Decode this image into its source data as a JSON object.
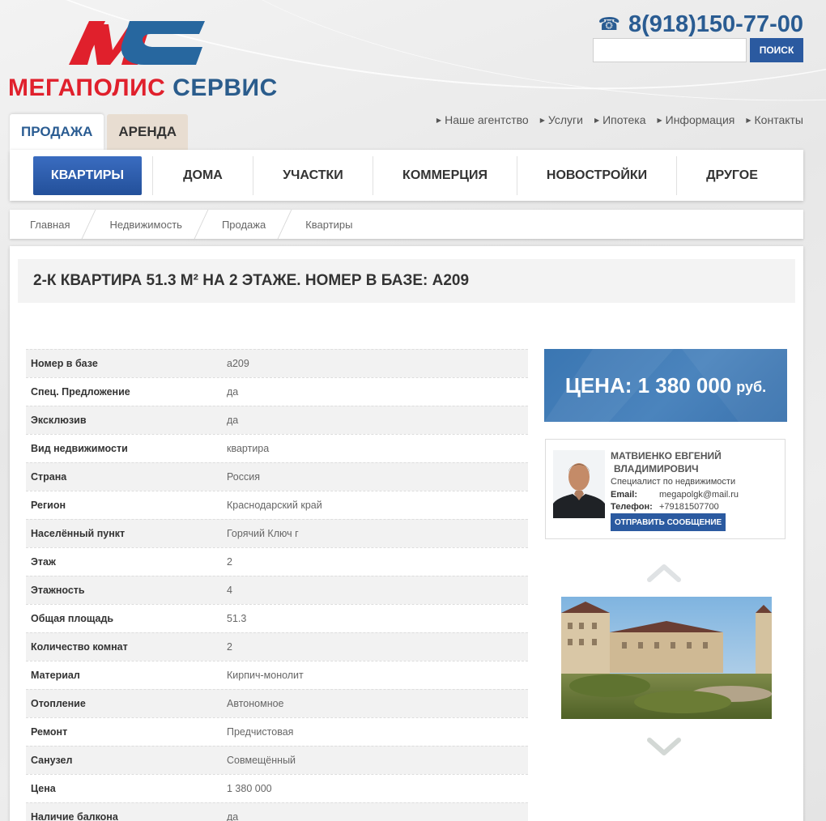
{
  "header": {
    "logo_text_part1": "МЕГАПОЛИС",
    "logo_text_part2": "СЕРВИС",
    "phone": "8(918)150-77-00",
    "search": {
      "placeholder": "",
      "button_label": "ПОИСК"
    }
  },
  "tabs": [
    {
      "label": "ПРОДАЖА",
      "active": true
    },
    {
      "label": "АРЕНДА",
      "active": false
    }
  ],
  "topnav": [
    "Наше агентство",
    "Услуги",
    "Ипотека",
    "Информация",
    "Контакты"
  ],
  "menu": [
    {
      "label": "КВАРТИРЫ",
      "active": true
    },
    {
      "label": "ДОМА",
      "active": false
    },
    {
      "label": "УЧАСТКИ",
      "active": false
    },
    {
      "label": "КОММЕРЦИЯ",
      "active": false
    },
    {
      "label": "НОВОСТРОЙКИ",
      "active": false
    },
    {
      "label": "ДРУГОЕ",
      "active": false
    }
  ],
  "breadcrumb": [
    "Главная",
    "Недвижимость",
    "Продажа",
    "Квартиры"
  ],
  "page_title": "2-К КВАРТИРА 51.3 М² НА 2 ЭТАЖЕ. НОМЕР В БАЗЕ: А209",
  "properties": [
    {
      "key": "Номер в базе",
      "value": "a209"
    },
    {
      "key": "Спец. Предложение",
      "value": "да"
    },
    {
      "key": "Эксклюзив",
      "value": "да"
    },
    {
      "key": "Вид недвижимости",
      "value": "квартира"
    },
    {
      "key": "Страна",
      "value": "Россия"
    },
    {
      "key": "Регион",
      "value": "Краснодарский край"
    },
    {
      "key": "Населённый пункт",
      "value": "Горячий Ключ г"
    },
    {
      "key": "Этаж",
      "value": "2"
    },
    {
      "key": "Этажность",
      "value": "4"
    },
    {
      "key": "Общая площадь",
      "value": "51.3"
    },
    {
      "key": "Количество комнат",
      "value": "2"
    },
    {
      "key": "Материал",
      "value": "Кирпич-монолит"
    },
    {
      "key": "Отопление",
      "value": "Автономное"
    },
    {
      "key": "Ремонт",
      "value": "Предчистовая"
    },
    {
      "key": "Санузел",
      "value": "Совмещённый"
    },
    {
      "key": "Цена",
      "value": "1 380 000"
    },
    {
      "key": "Наличие балкона",
      "value": "да"
    }
  ],
  "price": {
    "label": "ЦЕНА: 1 380 000",
    "currency": "руб."
  },
  "agent": {
    "name_line1": "МАТВИЕНКО ЕВГЕНИЙ",
    "name_line2": "ВЛАДИМИРОВИЧ",
    "role": "Специалист по недвижимости",
    "email_label": "Email:",
    "email": "megapolgk@mail.ru",
    "phone_label": "Телефон:",
    "phone": "+79181507700",
    "message_button": "ОТПРАВИТЬ СООБЩЕНИЕ"
  },
  "colors": {
    "brand_blue": "#2a5c92",
    "brand_red": "#e0202c",
    "button_blue": "#2b5aa0",
    "price_bg": "#3f7ab5"
  }
}
